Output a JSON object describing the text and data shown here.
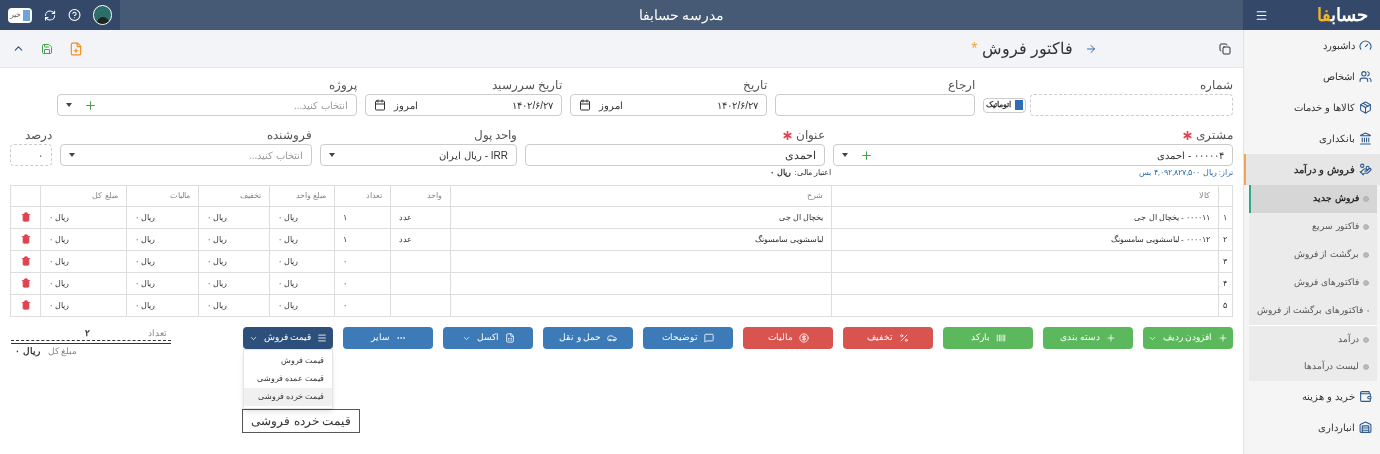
{
  "topbar": {
    "logo": "حساب",
    "logo_accent": "فا",
    "title": "مدرسه حسابفا",
    "toggle": {
      "label": "خیر",
      "on": false
    }
  },
  "sidebar": {
    "items": [
      {
        "label": "داشبورد",
        "selected": false
      },
      {
        "label": "اشخاص",
        "selected": false
      },
      {
        "label": "کالاها و خدمات",
        "selected": false
      },
      {
        "label": "بانکداری",
        "selected": false
      },
      {
        "label": "فروش و درآمد",
        "selected": true,
        "expanded": true,
        "children": [
          {
            "label": "فروش جدید",
            "selected": true
          },
          {
            "label": "فاکتور سریع",
            "selected": false
          },
          {
            "label": "برگشت از فروش",
            "selected": false
          },
          {
            "label": "فاکتورهای فروش",
            "selected": false
          },
          {
            "label": "فاکتورهای برگشت از فروش",
            "selected": false
          },
          {
            "label": "درآمد",
            "selected": false,
            "divider_before": true
          },
          {
            "label": "لیست درآمدها",
            "selected": false
          }
        ]
      },
      {
        "label": "خرید و هزینه",
        "selected": false
      },
      {
        "label": "انبارداری",
        "selected": false
      }
    ]
  },
  "page": {
    "title": "فاکتور فروش",
    "unsaved_mark": "*"
  },
  "form": {
    "row1": [
      {
        "kind": "number",
        "label": "شماره",
        "auto": {
          "label": "اتوماتیک",
          "checked": true
        }
      },
      {
        "kind": "text",
        "label": "ارجاع"
      },
      {
        "kind": "date",
        "label": "تاریخ",
        "value": "۱۴۰۲/۶/۲۷",
        "button": "امروز"
      },
      {
        "kind": "date",
        "label": "تاریخ سررسید",
        "value": "۱۴۰۲/۶/۲۷",
        "button": "امروز"
      },
      {
        "kind": "select_add",
        "label": "پروژه",
        "placeholder": "انتخاب کنید..."
      }
    ],
    "row2": [
      {
        "kind": "select_add",
        "label": "مشتری",
        "required": true,
        "value": "۰۰۰۰۰۴ - احمدی"
      },
      {
        "kind": "text",
        "label": "عنوان",
        "required": true,
        "value": "احمدی"
      },
      {
        "kind": "select",
        "label": "واحد پول",
        "value": "IRR - ریال ایران"
      },
      {
        "kind": "select",
        "label": "فروشنده",
        "placeholder": "انتخاب کنید..."
      },
      {
        "kind": "percent",
        "label": "درصد",
        "value": "۰"
      }
    ],
    "balance": "تراز: ریال ۴,۰۹۲,۸۲۷,۵۰۰ بس",
    "credit_label": "اعتبار مالی:",
    "credit_value": "ریال ۰"
  },
  "table": {
    "columns": [
      "کالا",
      "شرح",
      "واحد",
      "تعداد",
      "مبلغ واحد",
      "تخفیف",
      "مالیات",
      "مبلغ کل"
    ],
    "rows": [
      {
        "num": "۱",
        "cells": [
          "۰۰۰۰۱۱ - یخچال ال جی",
          "یخچال ال جی",
          "عدد",
          "۱",
          "ریال ۰",
          "ریال ۰",
          "ریال ۰",
          "ریال ۰"
        ]
      },
      {
        "num": "۲",
        "cells": [
          "۰۰۰۰۱۲ - لباسشویی سامسونگ",
          "لباسشویی سامسونگ",
          "عدد",
          "۱",
          "ریال ۰",
          "ریال ۰",
          "ریال ۰",
          "ریال ۰"
        ]
      },
      {
        "num": "۳",
        "cells": [
          "",
          "",
          "",
          "۰",
          "ریال ۰",
          "ریال ۰",
          "ریال ۰",
          "ریال ۰"
        ]
      },
      {
        "num": "۴",
        "cells": [
          "",
          "",
          "",
          "۰",
          "ریال ۰",
          "ریال ۰",
          "ریال ۰",
          "ریال ۰"
        ]
      },
      {
        "num": "۵",
        "cells": [
          "",
          "",
          "",
          "۰",
          "ریال ۰",
          "ریال ۰",
          "ریال ۰",
          "ریال ۰"
        ]
      }
    ]
  },
  "actions": [
    {
      "label": "افزودن ردیف",
      "color": "#5cb85c",
      "caret": true
    },
    {
      "label": "دسته بندی",
      "color": "#5cb85c",
      "caret": false
    },
    {
      "label": "بارکد",
      "color": "#5cb85c",
      "caret": false
    },
    {
      "label": "تخفیف",
      "color": "#d9534f",
      "caret": false
    },
    {
      "label": "مالیات",
      "color": "#d9534f",
      "caret": false
    },
    {
      "label": "توضیحات",
      "color": "#3c7ab8",
      "caret": false
    },
    {
      "label": "حمل و نقل",
      "color": "#3c7ab8",
      "caret": false
    },
    {
      "label": "اکسل",
      "color": "#3c7ab8",
      "caret": true
    },
    {
      "label": "سایر",
      "color": "#3c7ab8",
      "caret": false
    },
    {
      "label": "قیمت فروش",
      "color": "#2d4f7c",
      "caret": true,
      "expanded": true,
      "menu": [
        {
          "label": "قیمت فروش",
          "selected": false
        },
        {
          "label": "قیمت عمده فروشی",
          "selected": false
        },
        {
          "label": "قیمت خرده فروشی",
          "selected": true
        }
      ]
    }
  ],
  "totals": {
    "count_label": "تعداد",
    "count": "۲",
    "sum_label": "مبلغ کل",
    "sum": "ریال ۰"
  },
  "tooltip": "قیمت خرده فروشی"
}
